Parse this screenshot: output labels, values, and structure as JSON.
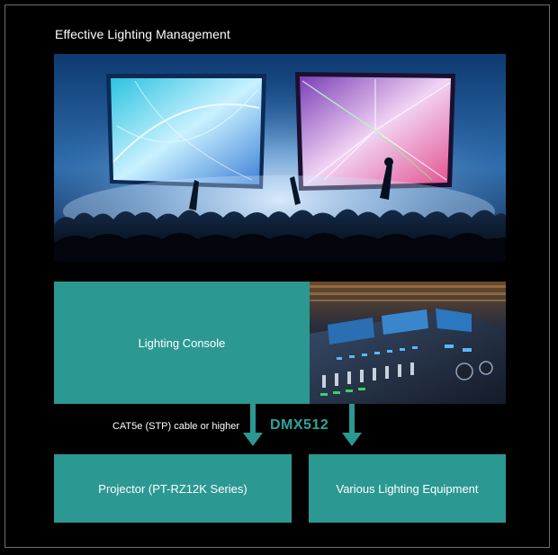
{
  "heading": "Effective Lighting Management",
  "console": {
    "label": "Lighting Console"
  },
  "connection": {
    "cable": "CAT5e (STP) cable or higher",
    "protocol": "DMX512"
  },
  "outputs": [
    {
      "label": "Projector (PT-RZ12K Series)"
    },
    {
      "label": "Various Lighting Equipment"
    }
  ],
  "colors": {
    "background": "#000000",
    "box": "#2c9892",
    "protocol_text": "#2ba59e",
    "frame_border": "#6f6f6f"
  },
  "images": {
    "top": "concert-crowd-with-laser-screens",
    "console": "lighting-console-photo"
  }
}
